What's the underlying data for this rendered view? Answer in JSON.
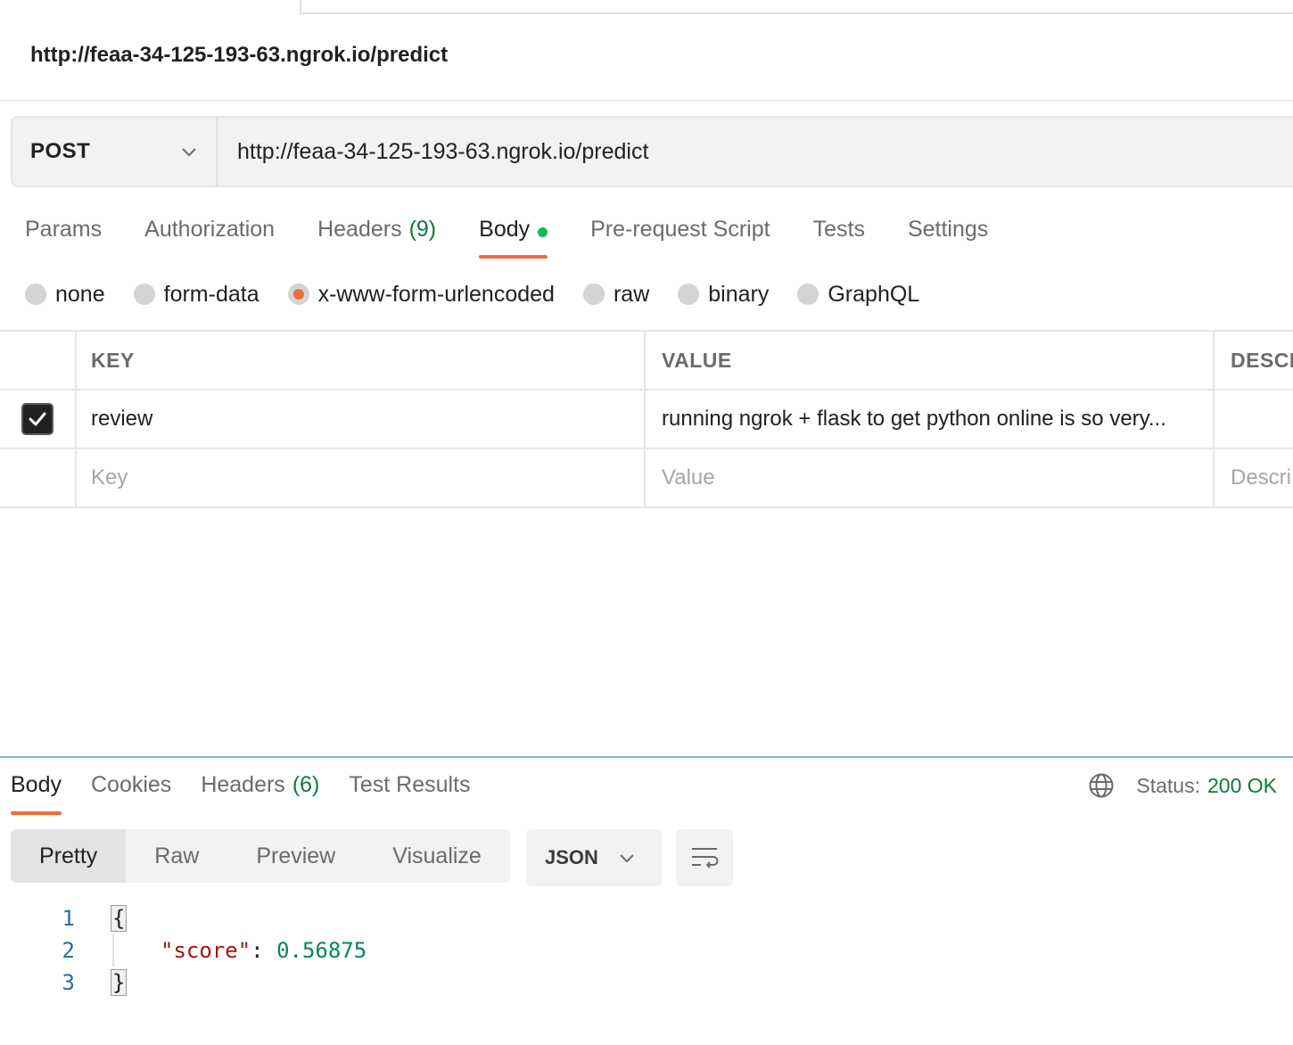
{
  "request": {
    "title": "http://feaa-34-125-193-63.ngrok.io/predict",
    "method": "POST",
    "url": "http://feaa-34-125-193-63.ngrok.io/predict"
  },
  "request_tabs": [
    {
      "label": "Params"
    },
    {
      "label": "Authorization"
    },
    {
      "label": "Headers",
      "count": "(9)"
    },
    {
      "label": "Body",
      "active": true
    },
    {
      "label": "Pre-request Script"
    },
    {
      "label": "Tests"
    },
    {
      "label": "Settings"
    }
  ],
  "body_modes": [
    {
      "label": "none"
    },
    {
      "label": "form-data"
    },
    {
      "label": "x-www-form-urlencoded",
      "selected": true
    },
    {
      "label": "raw"
    },
    {
      "label": "binary"
    },
    {
      "label": "GraphQL"
    }
  ],
  "params_table": {
    "headers": {
      "key": "KEY",
      "value": "VALUE",
      "description": "DESCR"
    },
    "rows": [
      {
        "checked": true,
        "key": "review",
        "value": "running ngrok + flask to get python online is so very..."
      }
    ],
    "placeholders": {
      "key": "Key",
      "value": "Value",
      "description": "Descri"
    }
  },
  "response_tabs": [
    {
      "label": "Body",
      "active": true
    },
    {
      "label": "Cookies"
    },
    {
      "label": "Headers",
      "count": "(6)"
    },
    {
      "label": "Test Results"
    }
  ],
  "status": {
    "label": "Status:",
    "value": "200 OK"
  },
  "view_modes": [
    "Pretty",
    "Raw",
    "Preview",
    "Visualize"
  ],
  "format": "JSON",
  "code": {
    "line_numbers": [
      "1",
      "2",
      "3"
    ],
    "open_brace": "{",
    "key": "\"score\"",
    "colon": ":",
    "value": "0.56875",
    "close_brace": "}"
  },
  "colors": {
    "accent": "#f26b3a",
    "status_ok": "#0c7a3d",
    "body_dot": "#0cbb52",
    "json_key": "#a31515",
    "json_number": "#098658"
  },
  "icons": [
    "chevron-down-icon",
    "checkmark-icon",
    "globe-icon",
    "wrap-lines-icon"
  ]
}
